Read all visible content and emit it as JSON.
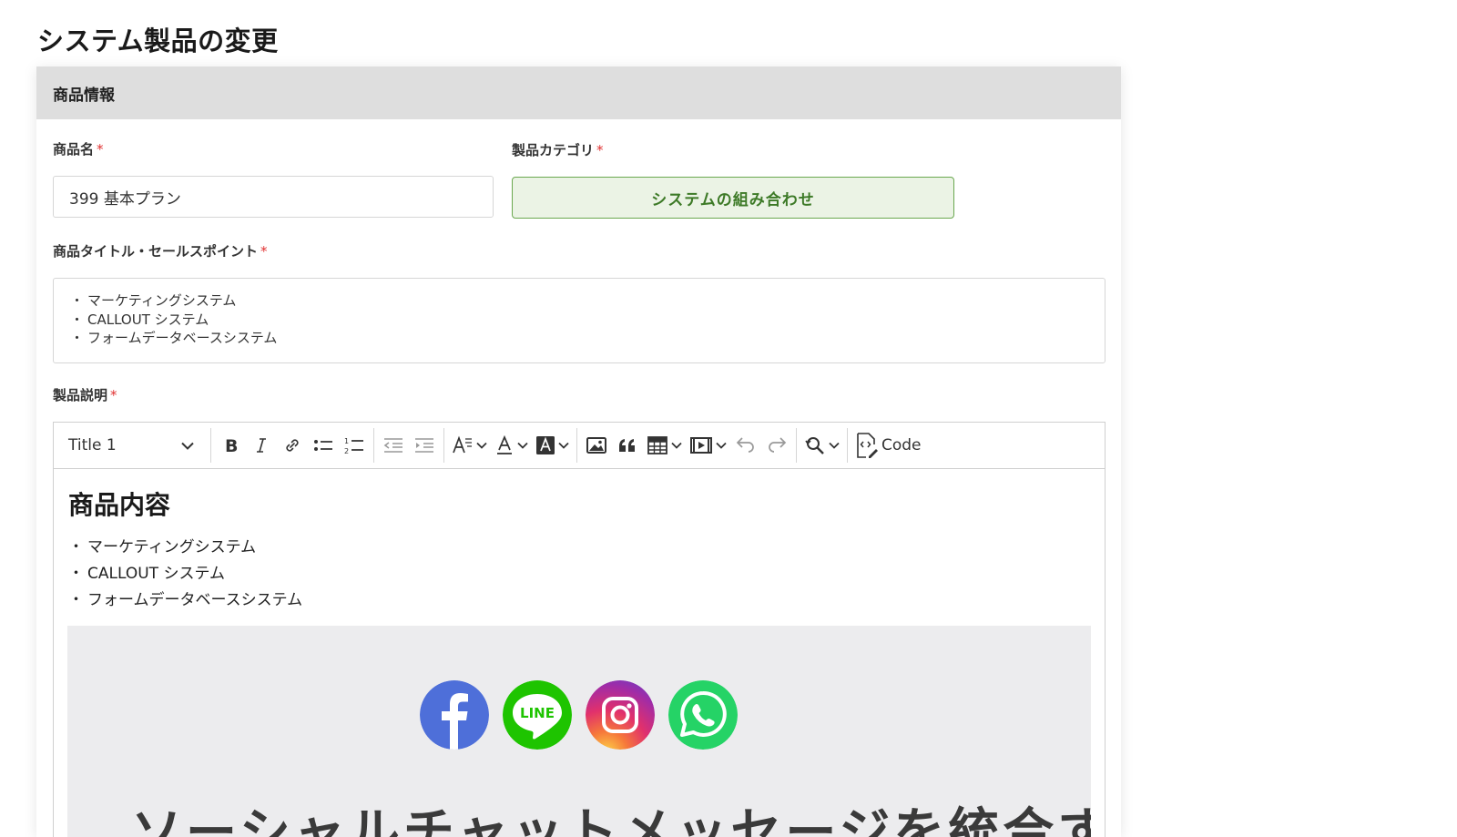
{
  "page": {
    "title": "システム製品の変更"
  },
  "card": {
    "header": "商品情報"
  },
  "fields": {
    "product_name": {
      "label": "商品名",
      "required": "*",
      "value": "399 基本プラン"
    },
    "category": {
      "label": "製品カテゴリ",
      "required": "*",
      "value": "システムの組み合わせ"
    },
    "title_points": {
      "label": "商品タイトル・セールスポイント",
      "required": "*",
      "items": [
        "マーケティングシステム",
        "CALLOUT システム",
        "フォームデータベースシステム"
      ]
    },
    "description": {
      "label": "製品説明",
      "required": "*"
    }
  },
  "editor": {
    "toolbar": {
      "heading_select": "Title 1",
      "code_label": "Code",
      "icons": [
        "bold-icon",
        "italic-icon",
        "link-icon",
        "bulleted-list-icon",
        "numbered-list-icon",
        "outdent-icon",
        "indent-icon",
        "font-size-icon",
        "font-color-icon",
        "font-background-icon",
        "image-icon",
        "blockquote-icon",
        "table-icon",
        "media-icon",
        "undo-icon",
        "redo-icon",
        "find-replace-icon",
        "source-code-icon"
      ]
    },
    "content": {
      "heading": "商品内容",
      "items": [
        "マーケティングシステム",
        "CALLOUT システム",
        "フォームデータベースシステム"
      ],
      "banner_headline": "ソーシャルチャットメッセージを統合する",
      "social_icons": [
        "facebook-icon",
        "line-icon",
        "instagram-icon",
        "whatsapp-icon"
      ]
    }
  },
  "colors": {
    "category_border": "#6aa84f",
    "category_bg": "#ebf3e5",
    "category_text": "#3d7a27",
    "required": "#e03131",
    "facebook": "#4e6fd9",
    "line": "#1ec400",
    "whatsapp": "#25d366"
  }
}
